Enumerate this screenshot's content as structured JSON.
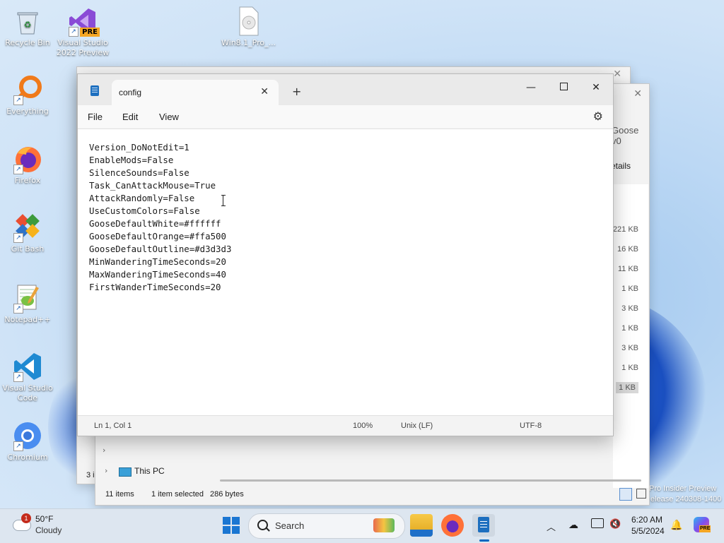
{
  "desktop": {
    "icons": [
      {
        "label": "Recycle Bin",
        "icon": "recycle-bin-icon"
      },
      {
        "label": "Visual Studio 2022 Preview",
        "icon": "visual-studio-preview-icon",
        "badge": "PRE"
      },
      {
        "label": "Win8.1_Pro_...",
        "icon": "disc-image-file-icon"
      },
      {
        "label": "Everything",
        "icon": "everything-search-icon"
      },
      {
        "label": "Firefox",
        "icon": "firefox-icon"
      },
      {
        "label": "Git Bash",
        "icon": "git-bash-icon"
      },
      {
        "label": "Notepad++",
        "icon": "notepad-plus-plus-icon"
      },
      {
        "label": "Visual Studio Code",
        "icon": "vscode-icon"
      },
      {
        "label": "Chromium",
        "icon": "chromium-icon"
      }
    ],
    "watermark": {
      "line1": "Pro Insider Preview",
      "line2": "Evaluation copy. Build 26100.ge_release.240308-1400",
      "line2_visible_right": "elease 240308-1400"
    }
  },
  "explorer": {
    "title_fragment": "Goose v0",
    "details_label": "etails",
    "sizes": [
      "221 KB",
      "16 KB",
      "11 KB",
      "1 KB",
      "3 KB",
      "1 KB",
      "3 KB",
      "1 KB",
      "1 KB"
    ],
    "nav": {
      "this_pc": "This PC",
      "count_fragment": "3 i"
    },
    "status": {
      "items": "11 items",
      "selected": "1 item selected",
      "size": "286 bytes"
    }
  },
  "notepad": {
    "tab_title": "config",
    "menu": [
      "File",
      "Edit",
      "View"
    ],
    "lines": [
      "Version_DoNotEdit=1",
      "EnableMods=False",
      "SilenceSounds=False",
      "Task_CanAttackMouse=True",
      "AttackRandomly=False",
      "UseCustomColors=False",
      "GooseDefaultWhite=#ffffff",
      "GooseDefaultOrange=#ffa500",
      "GooseDefaultOutline=#d3d3d3",
      "MinWanderingTimeSeconds=20",
      "MaxWanderingTimeSeconds=40",
      "FirstWanderTimeSeconds=20"
    ],
    "status": {
      "position": "Ln 1, Col 1",
      "zoom": "100%",
      "line_ending": "Unix (LF)",
      "encoding": "UTF-8"
    }
  },
  "taskbar": {
    "weather": {
      "temp": "50°F",
      "condition": "Cloudy",
      "alert_count": "1"
    },
    "search_label": "Search",
    "clock": {
      "time": "6:20 AM",
      "date": "5/5/2024"
    },
    "copilot_badge": "PRE"
  },
  "colors": {
    "accent": "#0067c0",
    "taskbar": "#dde6f0",
    "notepad_bg": "#f3f3f3",
    "editor_bg": "#ffffff"
  }
}
